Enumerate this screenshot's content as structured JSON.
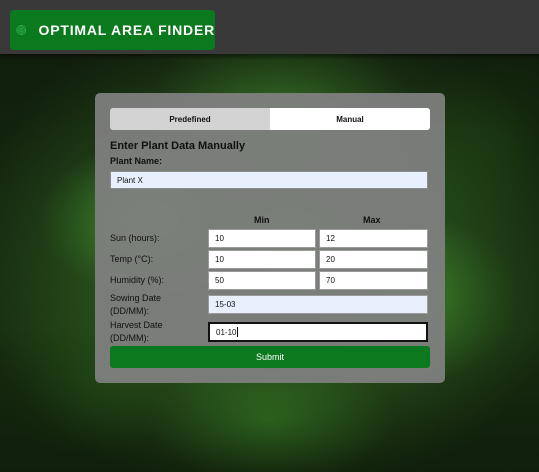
{
  "header": {
    "brand_title": "OPTIMAL AREA FINDER",
    "brand_color": "#0b7a1e",
    "bar_color": "#393939",
    "logo_icon": "target-leaf-icon"
  },
  "form": {
    "tabs": [
      {
        "label": "Predefined",
        "active": false
      },
      {
        "label": "Manual",
        "active": true
      }
    ],
    "heading": "Enter Plant Data Manually",
    "plant_name_label": "Plant Name:",
    "plant_name_value": "Plant X",
    "columns": {
      "min": "Min",
      "max": "Max"
    },
    "rows": [
      {
        "label": "Sun (hours):",
        "min": "10",
        "max": "12"
      },
      {
        "label": "Temp (°C):",
        "min": "10",
        "max": "20"
      },
      {
        "label": "Humidity (%):",
        "min": "50",
        "max": "70"
      }
    ],
    "sowing": {
      "label_line1": "Sowing Date",
      "label_line2": "(DD/MM):",
      "value": "15-03"
    },
    "harvest": {
      "label_line1": "Harvest Date",
      "label_line2": "(DD/MM):",
      "value": "01-10"
    },
    "submit_label": "Submit"
  }
}
